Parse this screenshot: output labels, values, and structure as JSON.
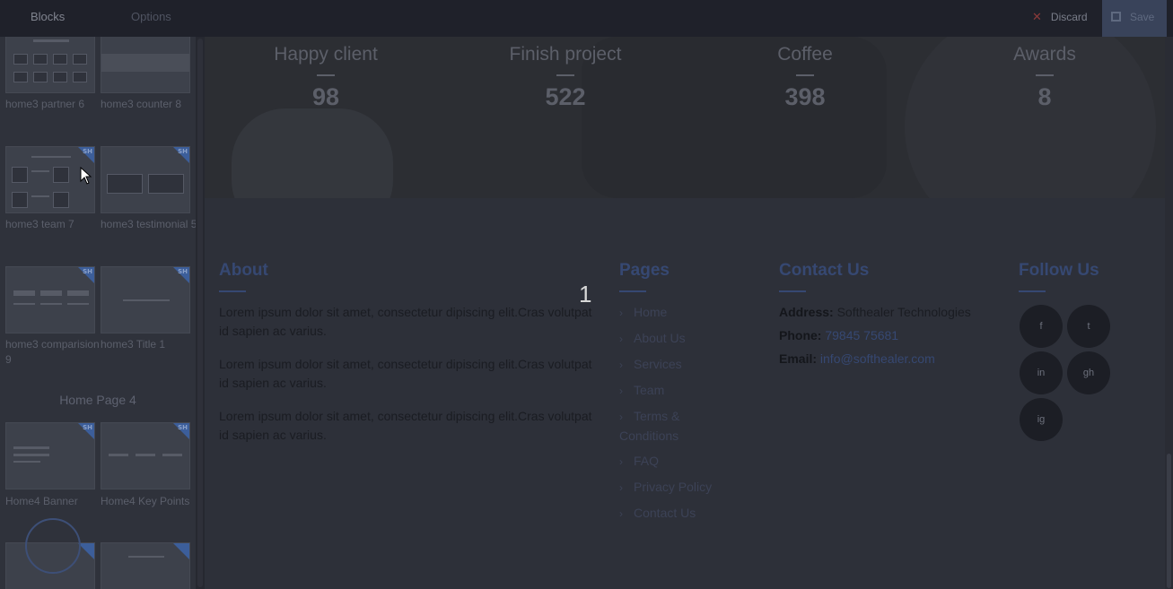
{
  "topbar": {
    "tabs": [
      "Blocks",
      "Options"
    ],
    "discard_label": "Discard",
    "save_label": "Save"
  },
  "sidebar": {
    "thumbs": [
      {
        "label": "home3 partner 6"
      },
      {
        "label": "home3 counter 8"
      },
      {
        "label": "home3 team 7",
        "badge": "SH"
      },
      {
        "label": "home3 testimonial 5",
        "badge": "SH"
      },
      {
        "label": "home3 comparision 9",
        "badge": "SH"
      },
      {
        "label": "home3 Title 1",
        "badge": "SH"
      },
      {
        "label": "Home4 Banner",
        "badge": "SH"
      },
      {
        "label": "Home4 Key Points",
        "badge": "SH"
      }
    ],
    "section_title": "Home Page 4"
  },
  "hero": {
    "counters": [
      {
        "label": "Happy client",
        "value": "98"
      },
      {
        "label": "Finish project",
        "value": "522"
      },
      {
        "label": "Coffee",
        "value": "398"
      },
      {
        "label": "Awards",
        "value": "8"
      }
    ]
  },
  "footer": {
    "about": {
      "heading": "About",
      "paragraphs": [
        "Lorem ipsum dolor sit amet, consectetur dipiscing elit.Cras volutpat id sapien ac varius.",
        "Lorem ipsum dolor sit amet, consectetur dipiscing elit.Cras volutpat id sapien ac varius.",
        "Lorem ipsum dolor sit amet, consectetur dipiscing elit.Cras volutpat id sapien ac varius."
      ]
    },
    "pages": {
      "heading": "Pages",
      "links": [
        "Home",
        "About Us",
        "Services",
        "Team",
        "Terms & Conditions",
        "FAQ",
        "Privacy Policy",
        "Contact Us"
      ]
    },
    "contact": {
      "heading": "Contact Us",
      "address_label": "Address:",
      "address_value": "Softhealer Technologies",
      "phone_label": "Phone:",
      "phone_value": "79845 75681",
      "email_label": "Email:",
      "email_value": "info@softhealer.com"
    },
    "follow": {
      "heading": "Follow Us",
      "icons": [
        "f",
        "t",
        "in",
        "gh",
        "ig"
      ]
    },
    "overlay_number": "1"
  }
}
